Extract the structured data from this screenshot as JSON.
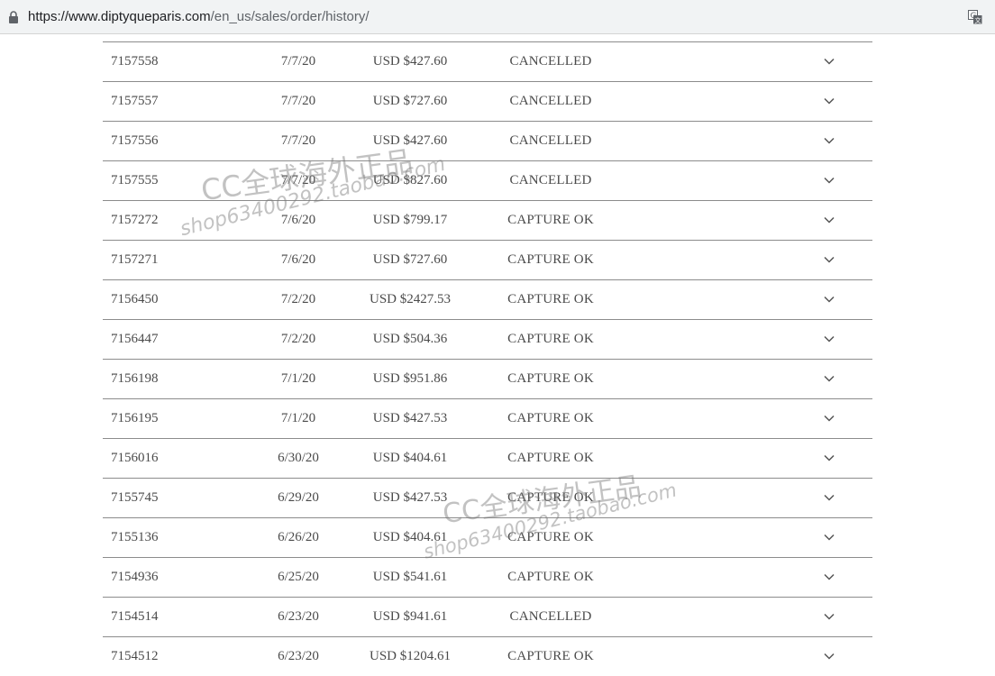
{
  "browser": {
    "url_host": "https://www.diptyqueparis.com",
    "url_path": "/en_us/sales/order/history/"
  },
  "orders": [
    {
      "order": "7157558",
      "date": "7/7/20",
      "total": "USD $427.60",
      "status": "CANCELLED"
    },
    {
      "order": "7157557",
      "date": "7/7/20",
      "total": "USD $727.60",
      "status": "CANCELLED"
    },
    {
      "order": "7157556",
      "date": "7/7/20",
      "total": "USD $427.60",
      "status": "CANCELLED"
    },
    {
      "order": "7157555",
      "date": "7/7/20",
      "total": "USD $827.60",
      "status": "CANCELLED"
    },
    {
      "order": "7157272",
      "date": "7/6/20",
      "total": "USD $799.17",
      "status": "CAPTURE OK"
    },
    {
      "order": "7157271",
      "date": "7/6/20",
      "total": "USD $727.60",
      "status": "CAPTURE OK"
    },
    {
      "order": "7156450",
      "date": "7/2/20",
      "total": "USD $2427.53",
      "status": "CAPTURE OK"
    },
    {
      "order": "7156447",
      "date": "7/2/20",
      "total": "USD $504.36",
      "status": "CAPTURE OK"
    },
    {
      "order": "7156198",
      "date": "7/1/20",
      "total": "USD $951.86",
      "status": "CAPTURE OK"
    },
    {
      "order": "7156195",
      "date": "7/1/20",
      "total": "USD $427.53",
      "status": "CAPTURE OK"
    },
    {
      "order": "7156016",
      "date": "6/30/20",
      "total": "USD $404.61",
      "status": "CAPTURE OK"
    },
    {
      "order": "7155745",
      "date": "6/29/20",
      "total": "USD $427.53",
      "status": "CAPTURE OK"
    },
    {
      "order": "7155136",
      "date": "6/26/20",
      "total": "USD $404.61",
      "status": "CAPTURE OK"
    },
    {
      "order": "7154936",
      "date": "6/25/20",
      "total": "USD $541.61",
      "status": "CAPTURE OK"
    },
    {
      "order": "7154514",
      "date": "6/23/20",
      "total": "USD $941.61",
      "status": "CANCELLED"
    },
    {
      "order": "7154512",
      "date": "6/23/20",
      "total": "USD $1204.61",
      "status": "CAPTURE OK"
    }
  ],
  "watermark": {
    "line1": "CC全球海外正品",
    "line2": "shop63400292.taobao.com"
  }
}
